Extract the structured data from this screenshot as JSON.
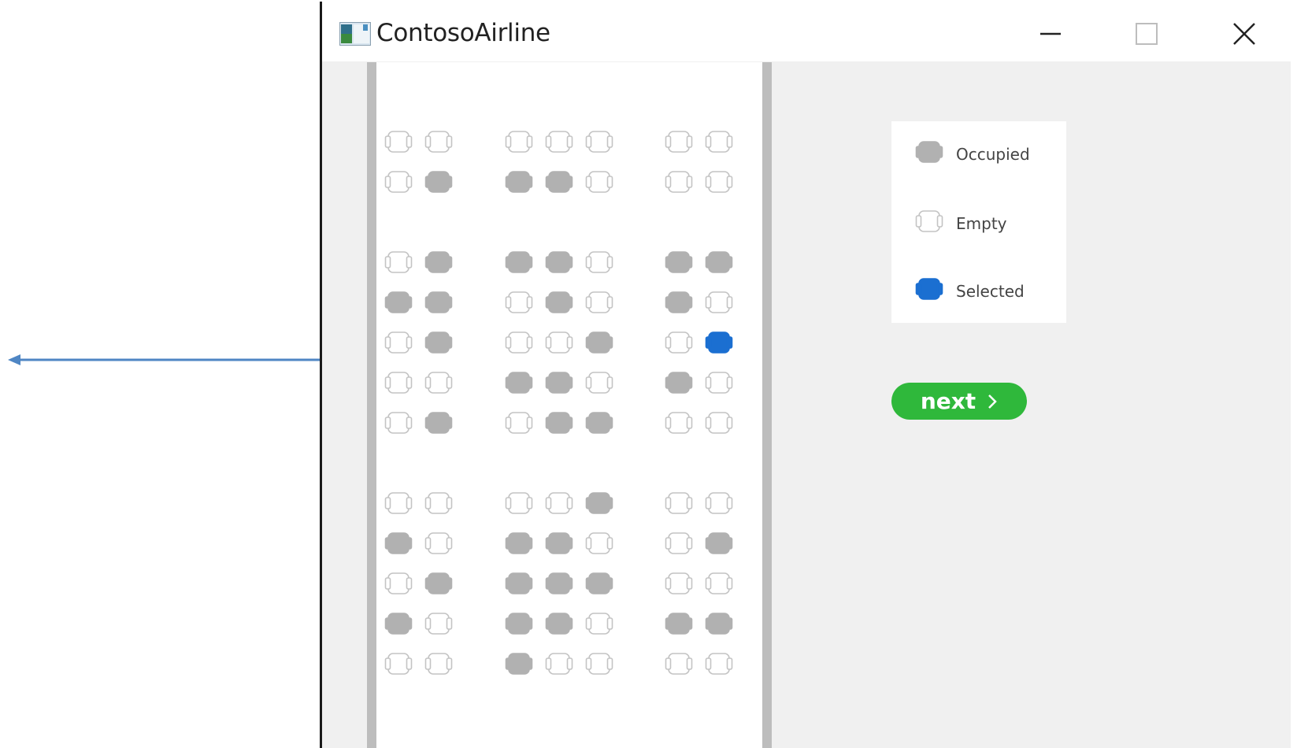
{
  "window": {
    "title": "ContosoAirline"
  },
  "colors": {
    "occupied": "#b1b1b1",
    "empty_outline": "#c4c4c4",
    "selected": "#1b6fd1",
    "next_button": "#2fb83b",
    "arrow": "#4f86c4"
  },
  "icons": {
    "app": "app-window-icon",
    "minimize": "minimize-icon",
    "maximize": "maximize-icon",
    "close": "close-icon",
    "next": "chevron-right-icon"
  },
  "seat_map": {
    "rows": [
      [
        "E",
        "E",
        "E",
        "E",
        "E",
        "E",
        "E"
      ],
      [
        "E",
        "O",
        "O",
        "O",
        "E",
        "E",
        "E"
      ],
      [
        "E",
        "O",
        "O",
        "O",
        "E",
        "O",
        "O"
      ],
      [
        "O",
        "O",
        "E",
        "O",
        "E",
        "O",
        "E"
      ],
      [
        "E",
        "O",
        "E",
        "E",
        "O",
        "E",
        "S"
      ],
      [
        "E",
        "E",
        "O",
        "O",
        "E",
        "O",
        "E"
      ],
      [
        "E",
        "O",
        "E",
        "O",
        "O",
        "E",
        "E"
      ],
      [
        "E",
        "E",
        "E",
        "E",
        "O",
        "E",
        "E"
      ],
      [
        "O",
        "E",
        "O",
        "O",
        "E",
        "E",
        "O"
      ],
      [
        "E",
        "O",
        "O",
        "O",
        "O",
        "E",
        "E"
      ],
      [
        "O",
        "E",
        "O",
        "O",
        "E",
        "O",
        "O"
      ],
      [
        "E",
        "E",
        "O",
        "E",
        "E",
        "E",
        "E"
      ]
    ]
  },
  "legend": {
    "occupied": "Occupied",
    "empty": "Empty",
    "selected": "Selected"
  },
  "next_button": {
    "label": "next"
  }
}
